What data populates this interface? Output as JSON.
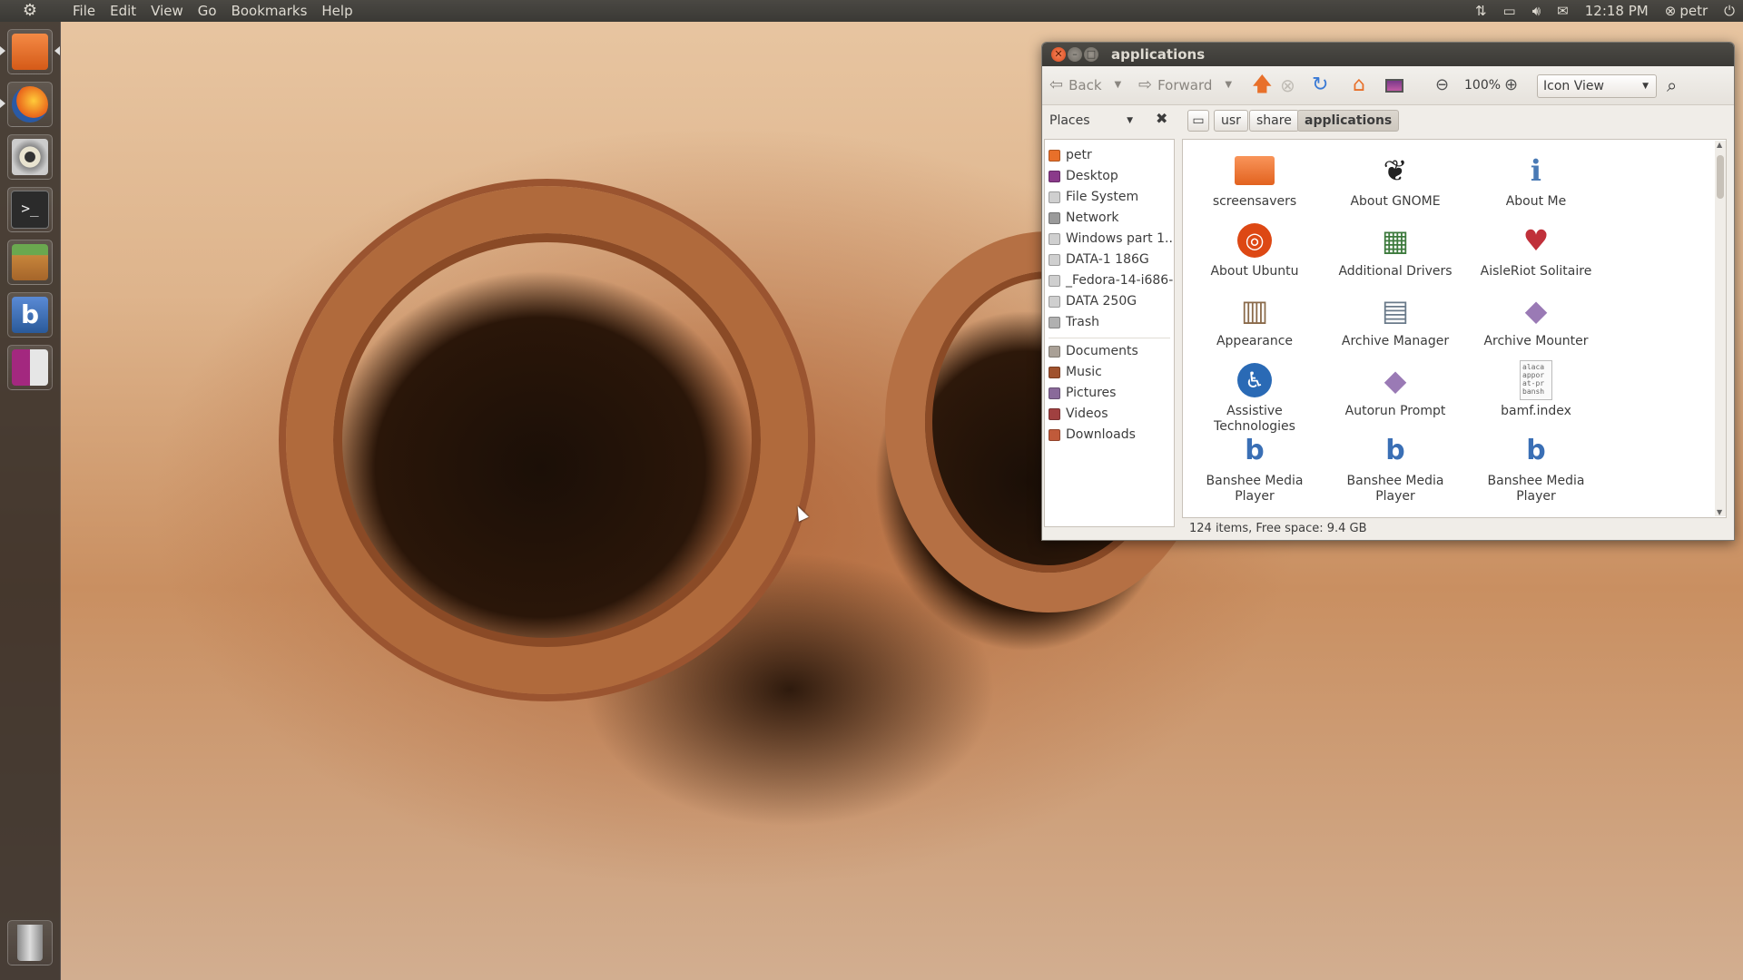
{
  "top_panel": {
    "menu": [
      "File",
      "Edit",
      "View",
      "Go",
      "Bookmarks",
      "Help"
    ],
    "clock": "12:18 PM",
    "user": "petr"
  },
  "launcher": {
    "items": [
      {
        "name": "home-folder",
        "color": "#e8702a"
      },
      {
        "name": "firefox",
        "color": "#e06b1b"
      },
      {
        "name": "rhythmbox",
        "color": "#b8b8b0"
      },
      {
        "name": "terminal",
        "color": "#2b2b2b"
      },
      {
        "name": "software-center",
        "color": "#c7853b"
      },
      {
        "name": "banshee",
        "color": "#3a6fb5"
      },
      {
        "name": "workspace-switcher",
        "color": "#a3287f"
      }
    ]
  },
  "window": {
    "title": "applications",
    "toolbar": {
      "back": "Back",
      "forward": "Forward",
      "zoom": "100%",
      "view_mode": "Icon View"
    },
    "places_label": "Places",
    "breadcrumbs": [
      "usr",
      "share",
      "applications"
    ],
    "sidebar": {
      "devices": [
        {
          "label": "petr",
          "color": "#e8702a"
        },
        {
          "label": "Desktop",
          "color": "#8a3a8a"
        },
        {
          "label": "File System",
          "color": "#cfcfcf"
        },
        {
          "label": "Network",
          "color": "#9a9a9a"
        },
        {
          "label": "Windows part 1...",
          "color": "#cfcfcf"
        },
        {
          "label": "DATA-1 186G",
          "color": "#cfcfcf"
        },
        {
          "label": "_Fedora-14-i686-",
          "color": "#cfcfcf"
        },
        {
          "label": "DATA 250G",
          "color": "#cfcfcf"
        },
        {
          "label": "Trash",
          "color": "#b0b0b0"
        }
      ],
      "bookmarks": [
        {
          "label": "Documents",
          "color": "#a9a096"
        },
        {
          "label": "Music",
          "color": "#a0522d"
        },
        {
          "label": "Pictures",
          "color": "#8a6a9a"
        },
        {
          "label": "Videos",
          "color": "#a04040"
        },
        {
          "label": "Downloads",
          "color": "#c05a3a"
        }
      ]
    },
    "files": [
      {
        "label": "screensavers",
        "icon": "folder-icon",
        "color": "#e8702a"
      },
      {
        "label": "About GNOME",
        "icon": "gnome-foot-icon",
        "color": "#222"
      },
      {
        "label": "About Me",
        "icon": "user-info-icon",
        "color": "#4a7ab5"
      },
      {
        "label": "About Ubuntu",
        "icon": "ubuntu-logo-icon",
        "color": "#dd4814"
      },
      {
        "label": "Additional Drivers",
        "icon": "drivers-icon",
        "color": "#3d7a3d"
      },
      {
        "label": "AisleRiot Solitaire",
        "icon": "cards-icon",
        "color": "#c0303a"
      },
      {
        "label": "Appearance",
        "icon": "appearance-icon",
        "color": "#8a6a4a"
      },
      {
        "label": "Archive Manager",
        "icon": "archive-icon",
        "color": "#6a7a8a"
      },
      {
        "label": "Archive Mounter",
        "icon": "diamond-icon",
        "color": "#9a7ab5"
      },
      {
        "label": "Assistive Technologies",
        "icon": "accessibility-icon",
        "color": "#2a6ab5"
      },
      {
        "label": "Autorun Prompt",
        "icon": "diamond-icon",
        "color": "#9a7ab5"
      },
      {
        "label": "bamf.index",
        "icon": "text-file-icon",
        "color": "#666"
      },
      {
        "label": "Banshee Media Player",
        "icon": "banshee-icon",
        "color": "#3a6fb5"
      },
      {
        "label": "Banshee Media Player",
        "icon": "banshee-icon",
        "color": "#3a6fb5"
      },
      {
        "label": "Banshee Media Player",
        "icon": "banshee-icon",
        "color": "#3a6fb5"
      }
    ],
    "text_file_preview": "alaca\nappor\nat-pr\nbansh",
    "status": "124 items, Free space: 9.4 GB"
  }
}
